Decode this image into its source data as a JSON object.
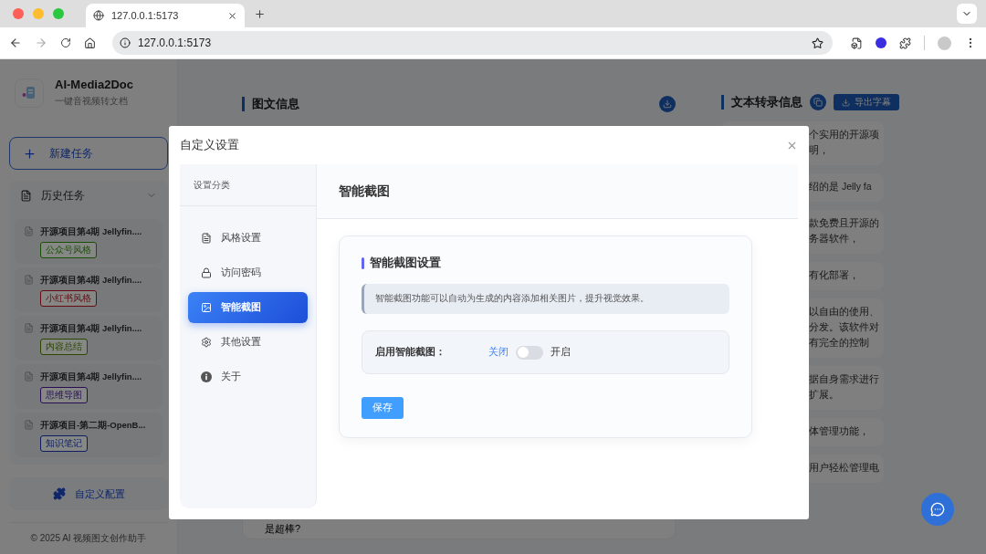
{
  "browser": {
    "tab_title": "127.0.0.1:5173",
    "address": "127.0.0.1:5173",
    "can_go_forward": false
  },
  "sidebar": {
    "app_name": "AI-Media2Doc",
    "tagline": "一键音视频转文档",
    "new_task": "新建任务",
    "history_title": "历史任务",
    "history_expanded": true,
    "history": [
      {
        "title": "开源项目第4期 Jellyfin....",
        "tag": "公众号风格",
        "color": "#1c4f06"
      },
      {
        "title": "开源项目第4期 Jellyfin....",
        "tag": "小红书风格",
        "color": "#670911"
      },
      {
        "title": "开源项目第4期 Jellyfin....",
        "tag": "内容总结",
        "color": "#2d4600"
      },
      {
        "title": "开源项目第4期 Jellyfin....",
        "tag": "思维导图",
        "color": "#290e55"
      },
      {
        "title": "开源项目-第二期-OpenB...",
        "tag": "知识笔记",
        "color": "#0e1c62"
      }
    ],
    "config_button": "自定义配置",
    "footer": "© 2025 AI 视频图文创作助手"
  },
  "article": {
    "title": "图文信息",
    "snippet": "是超棒?"
  },
  "transcript": {
    "title": "文本转录信息",
    "export_button": "导出字幕",
    "items": [
      [
        "个实用的开源项",
        "明，"
      ],
      [
        "绍的是 Jelly fa"
      ],
      [
        "款免费且开源的",
        "务器软件，"
      ],
      [
        "有化部署，"
      ],
      [
        "以自由的使用、",
        "分发。该软件对",
        "有完全的控制"
      ],
      [
        "据自身需求进行",
        "扩展。"
      ],
      [
        "体管理功能，"
      ],
      [
        "用户轻松管理电"
      ]
    ]
  },
  "dialog": {
    "title": "自定义设置",
    "nav_title": "设置分类",
    "nav": [
      {
        "label": "风格设置",
        "selected": false
      },
      {
        "label": "访问密码",
        "selected": false
      },
      {
        "label": "智能截图",
        "selected": true
      },
      {
        "label": "其他设置",
        "selected": false
      },
      {
        "label": "关于",
        "selected": false
      }
    ],
    "section_title": "智能截图",
    "card_title": "智能截图设置",
    "info": "智能截图功能可以自动为生成的内容添加相关图片，提升视觉效果。",
    "toggle": {
      "label": "启用智能截图：",
      "off_label": "关闭",
      "on_label": "开启",
      "on": false
    },
    "save_button": "保存"
  }
}
